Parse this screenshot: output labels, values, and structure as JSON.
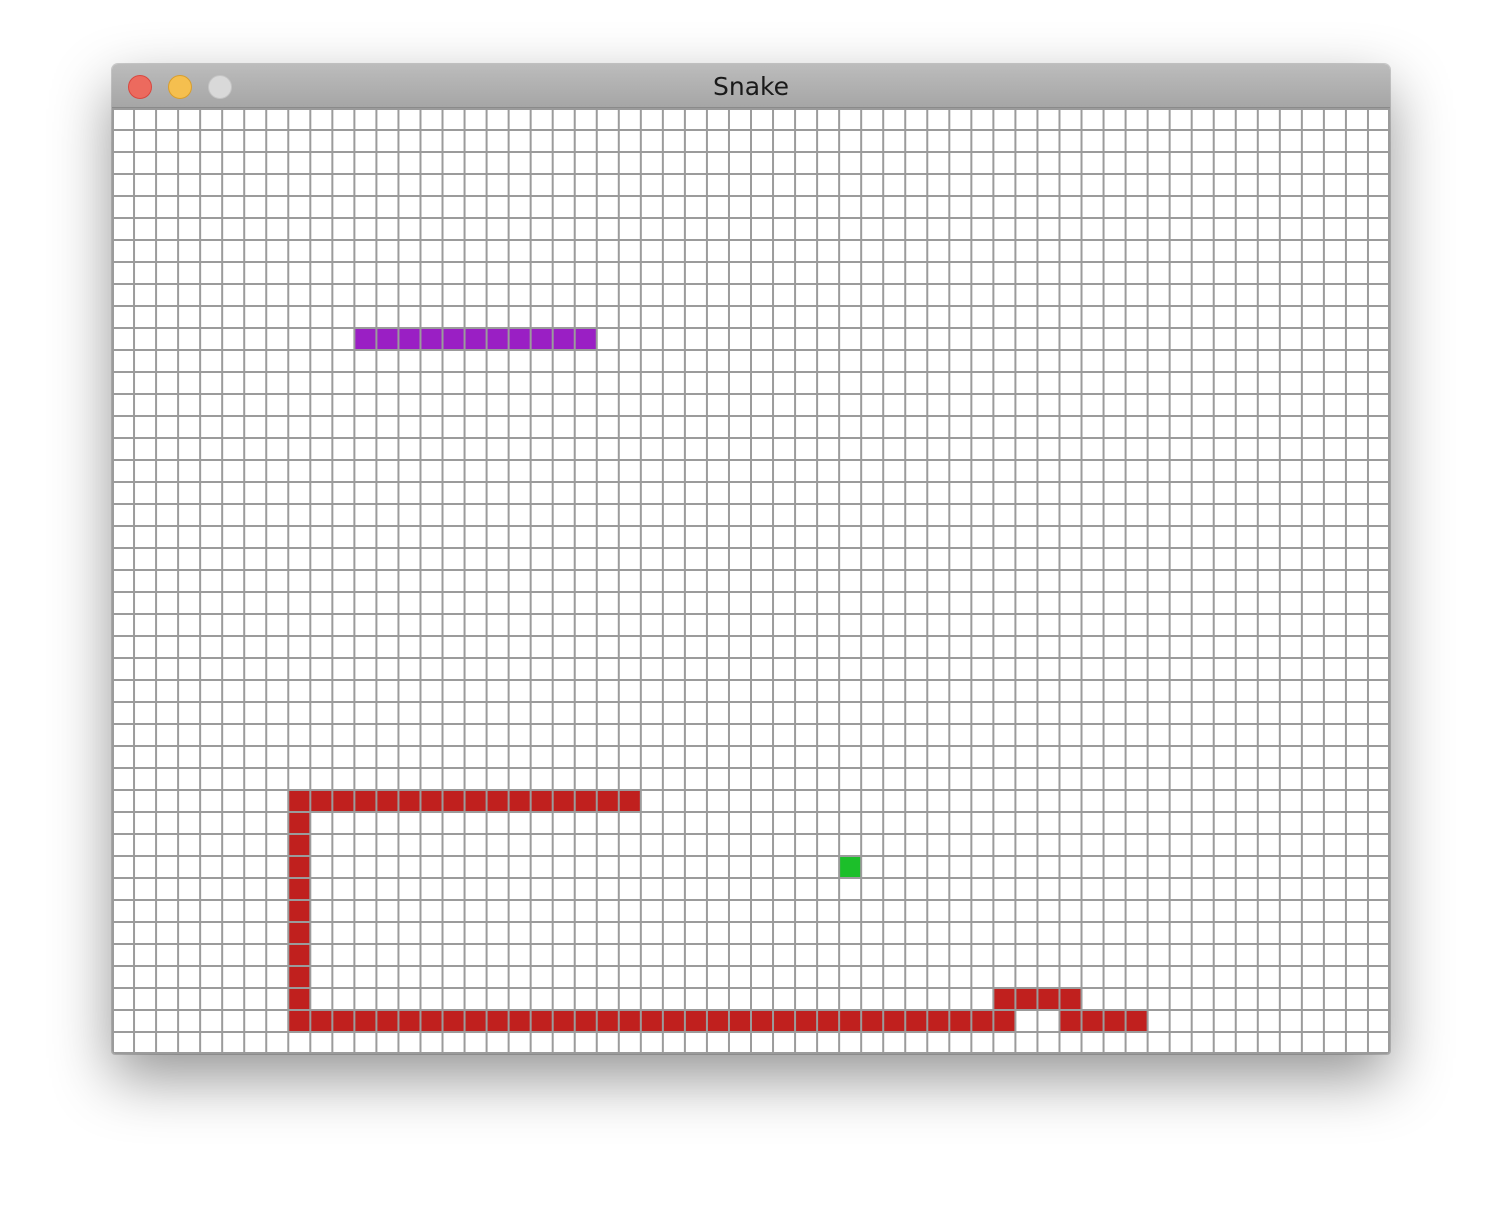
{
  "window": {
    "title": "Snake",
    "controls": {
      "close_color": "#ec6a5e",
      "minimize_color": "#f5bf4f",
      "zoom_color": "#d9d9d9"
    }
  },
  "game": {
    "grid": {
      "cols": 58,
      "rows": 43
    },
    "colors": {
      "grid_line": "#9b9b9b",
      "background": "#ffffff",
      "player_snake": "#c0201e",
      "enemy_snake": "#9a1fc4",
      "food": "#1cbf2a"
    },
    "purple_snake": {
      "cells": [
        [
          11,
          10
        ],
        [
          12,
          10
        ],
        [
          13,
          10
        ],
        [
          14,
          10
        ],
        [
          15,
          10
        ],
        [
          16,
          10
        ],
        [
          17,
          10
        ],
        [
          18,
          10
        ],
        [
          19,
          10
        ],
        [
          20,
          10
        ],
        [
          21,
          10
        ]
      ]
    },
    "red_snake": {
      "cells": [
        [
          23,
          31
        ],
        [
          22,
          31
        ],
        [
          21,
          31
        ],
        [
          20,
          31
        ],
        [
          19,
          31
        ],
        [
          18,
          31
        ],
        [
          17,
          31
        ],
        [
          16,
          31
        ],
        [
          15,
          31
        ],
        [
          14,
          31
        ],
        [
          13,
          31
        ],
        [
          12,
          31
        ],
        [
          11,
          31
        ],
        [
          10,
          31
        ],
        [
          9,
          31
        ],
        [
          8,
          31
        ],
        [
          8,
          32
        ],
        [
          8,
          33
        ],
        [
          8,
          34
        ],
        [
          8,
          35
        ],
        [
          8,
          36
        ],
        [
          8,
          37
        ],
        [
          8,
          38
        ],
        [
          8,
          39
        ],
        [
          8,
          40
        ],
        [
          9,
          41
        ],
        [
          10,
          41
        ],
        [
          11,
          41
        ],
        [
          12,
          41
        ],
        [
          13,
          41
        ],
        [
          14,
          41
        ],
        [
          15,
          41
        ],
        [
          16,
          41
        ],
        [
          17,
          41
        ],
        [
          18,
          41
        ],
        [
          19,
          41
        ],
        [
          20,
          41
        ],
        [
          21,
          41
        ],
        [
          22,
          41
        ],
        [
          23,
          41
        ],
        [
          24,
          41
        ],
        [
          25,
          41
        ],
        [
          26,
          41
        ],
        [
          27,
          41
        ],
        [
          28,
          41
        ],
        [
          29,
          41
        ],
        [
          30,
          41
        ],
        [
          31,
          41
        ],
        [
          32,
          41
        ],
        [
          33,
          41
        ],
        [
          34,
          41
        ],
        [
          35,
          41
        ],
        [
          36,
          41
        ],
        [
          37,
          41
        ],
        [
          38,
          41
        ],
        [
          39,
          41
        ],
        [
          40,
          41
        ],
        [
          40,
          40
        ],
        [
          41,
          40
        ],
        [
          42,
          40
        ],
        [
          43,
          40
        ],
        [
          43,
          41
        ],
        [
          44,
          41
        ],
        [
          45,
          41
        ],
        [
          46,
          41
        ],
        [
          8,
          41
        ]
      ]
    },
    "food": {
      "cells": [
        [
          33,
          34
        ]
      ]
    }
  }
}
